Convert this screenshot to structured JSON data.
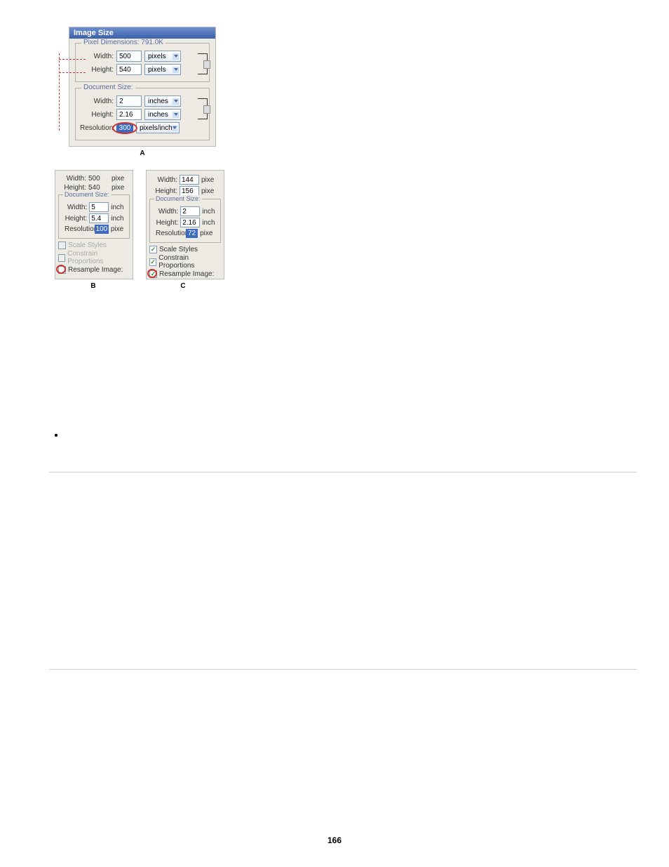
{
  "dialog_title": "Image Size",
  "pixel_dimensions_label": "Pixel Dimensions:",
  "pixel_dimensions_size": "791.0K",
  "panel_a": {
    "pixel": {
      "width_label": "Width:",
      "width_value": "500",
      "height_label": "Height:",
      "height_value": "540",
      "unit1": "pixels",
      "unit2": "pixels"
    },
    "doc": {
      "legend": "Document Size:",
      "width_label": "Width:",
      "width_value": "2",
      "height_label": "Height:",
      "height_value": "2.16",
      "unit1": "inches",
      "unit2": "inches",
      "res_label": "Resolution:",
      "res_value": "300",
      "res_unit": "pixels/inch"
    }
  },
  "label_a": "A",
  "panel_b": {
    "px": {
      "width_label": "Width:",
      "width_value": "500",
      "height_label": "Height:",
      "height_value": "540",
      "unit": "pixe"
    },
    "doc": {
      "legend": "Document Size:",
      "width_label": "Width:",
      "width_value": "5",
      "height_label": "Height:",
      "height_value": "5.4",
      "unit": "inch",
      "res_label": "Resolution:",
      "res_value": "100",
      "res_unit": "pixe"
    },
    "cb1": "Scale Styles",
    "cb2": "Constrain Proportions",
    "cb3": "Resample Image:"
  },
  "label_b": "B",
  "panel_c": {
    "px": {
      "width_label": "Width:",
      "width_value": "144",
      "height_label": "Height:",
      "height_value": "156",
      "unit": "pixe"
    },
    "doc": {
      "legend": "Document Size:",
      "width_label": "Width:",
      "width_value": "2",
      "height_label": "Height:",
      "height_value": "2.16",
      "unit": "inch",
      "res_label": "Resolution:",
      "res_value": "72",
      "res_unit": "pixe"
    },
    "cb1": "Scale Styles",
    "cb2": "Constrain Proportions",
    "cb3": "Resample Image:"
  },
  "label_c": "C",
  "page_number": "166"
}
